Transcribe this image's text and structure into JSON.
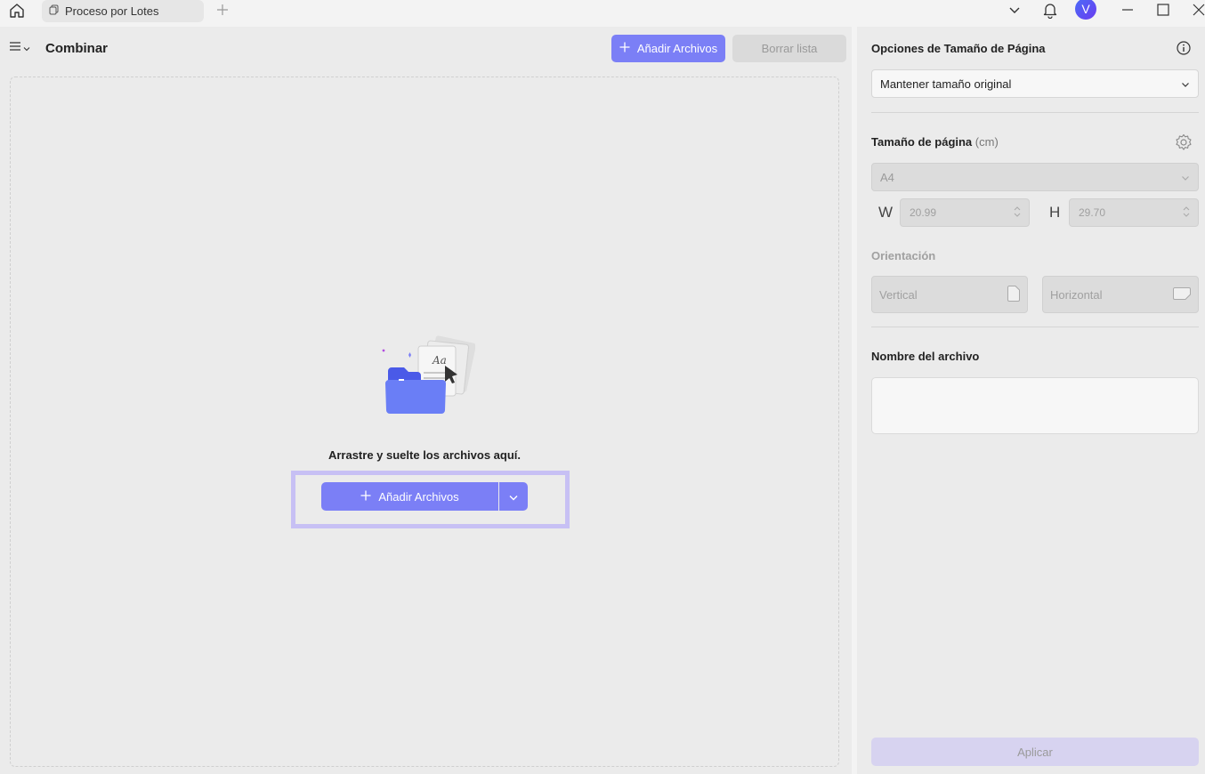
{
  "titlebar": {
    "tab_label": "Proceso por Lotes",
    "avatar_initial": "V"
  },
  "left": {
    "title": "Combinar",
    "add_files_label": "Añadir Archivos",
    "clear_list_label": "Borrar lista",
    "drop_text": "Arrastre y suelte los archivos aquí.",
    "add_files_main_label": "Añadir Archivos"
  },
  "right": {
    "page_size_options_title": "Opciones de Tamaño de Página",
    "size_mode_value": "Mantener tamaño original",
    "page_size_title": "Tamaño de página",
    "page_size_unit": "(cm)",
    "paper_value": "A4",
    "width_label": "W",
    "width_value": "20.99",
    "height_label": "H",
    "height_value": "29.70",
    "orientation_title": "Orientación",
    "vertical_label": "Vertical",
    "horizontal_label": "Horizontal",
    "file_name_title": "Nombre del archivo",
    "file_name_value": "",
    "apply_label": "Aplicar"
  },
  "colors": {
    "accent": "#7b7ff6",
    "highlight": "#c7c0f4",
    "apply_disabled": "#d7d3f0"
  }
}
